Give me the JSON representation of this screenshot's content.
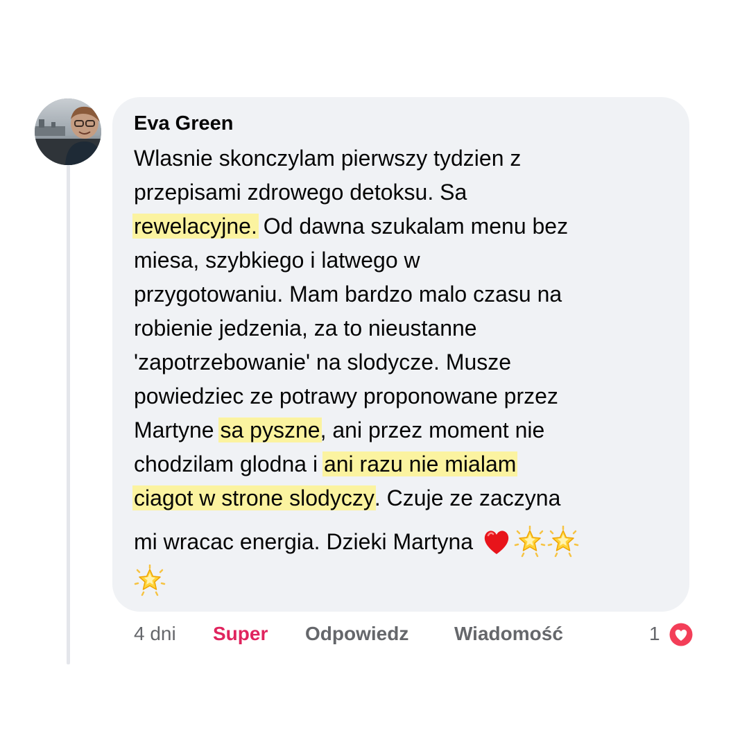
{
  "comment": {
    "author": "Eva Green",
    "lines": [
      [
        {
          "t": "Wlasnie skonczylam pierwszy tydzien z",
          "hl": false
        }
      ],
      [
        {
          "t": "przepisami zdrowego detoksu. Sa",
          "hl": false
        }
      ],
      [
        {
          "t": "rewelacyjne.",
          "hl": true
        },
        {
          "t": " Od dawna szukalam menu bez",
          "hl": false
        }
      ],
      [
        {
          "t": "miesa, szybkiego i latwego w",
          "hl": false
        }
      ],
      [
        {
          "t": "przygotowaniu. Mam bardzo malo czasu na",
          "hl": false
        }
      ],
      [
        {
          "t": "robienie jedzenia, za to nieustanne",
          "hl": false
        }
      ],
      [
        {
          "t": "'zapotrzebowanie' na slodycze. Musze",
          "hl": false
        }
      ],
      [
        {
          "t": "powiedziec ze potrawy proponowane przez",
          "hl": false
        }
      ],
      [
        {
          "t": "Martyne ",
          "hl": false
        },
        {
          "t": "sa pyszne",
          "hl": true
        },
        {
          "t": ", ani przez moment nie",
          "hl": false
        }
      ],
      [
        {
          "t": "chodzilam glodna i ",
          "hl": false
        },
        {
          "t": "ani razu nie mialam",
          "hl": true
        }
      ],
      [
        {
          "t": "ciagot w strone slodyczy",
          "hl": true
        },
        {
          "t": ". Czuje ze zaczyna",
          "hl": false
        }
      ],
      [
        {
          "t": "mi wracac energia. Dzieki Martyna ",
          "hl": false
        }
      ]
    ],
    "emojis_line12": [
      "red-heart-emoji",
      "glowing-star-emoji",
      "glowing-star-emoji"
    ],
    "emojis_line13": [
      "glowing-star-emoji"
    ]
  },
  "footer": {
    "time": "4 dni",
    "reaction_label": "Super",
    "reply_label": "Odpowiedz",
    "message_label": "Wiadomość",
    "reaction_count": "1",
    "reaction_icon": "heart-reaction-icon"
  },
  "colors": {
    "bubble": "#f0f2f5",
    "highlight": "#fbf3a0",
    "super": "#e0245e",
    "heart_badge": "#f33e58",
    "muted": "#65676b"
  }
}
